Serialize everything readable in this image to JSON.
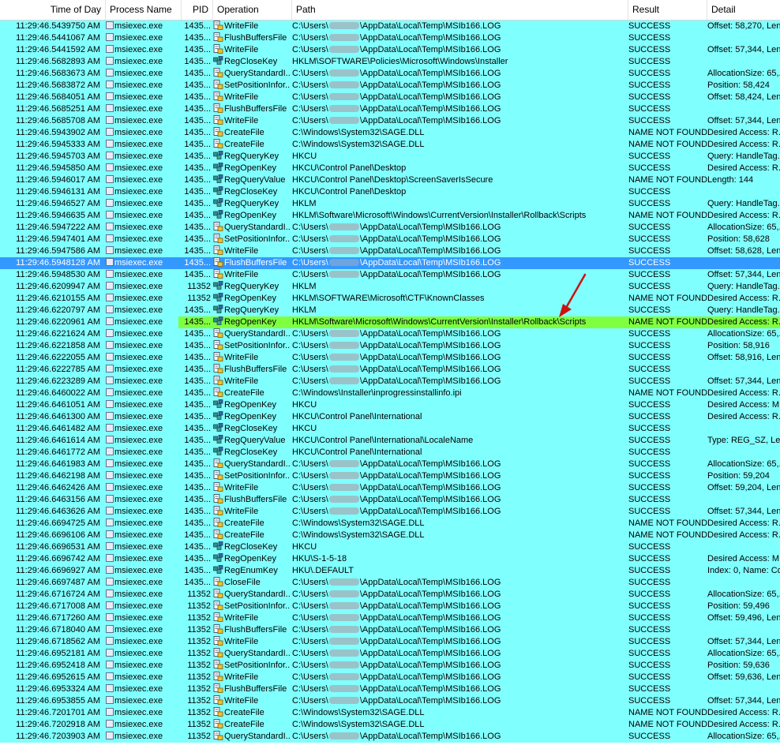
{
  "columns": {
    "time": "Time of Day",
    "process": "Process Name",
    "pid": "PID",
    "operation": "Operation",
    "path": "Path",
    "result": "Result",
    "detail": "Detail"
  },
  "colors": {
    "row_bg": "#80ffff",
    "selected_bg": "#3399ff",
    "highlight_bg": "#80ff40",
    "arrow": "#cc1111"
  },
  "rows": [
    {
      "time": "11:29:46.5439750 AM",
      "process": "msiexec.exe",
      "pid": "1435...",
      "op": "WriteFile",
      "icon": "file",
      "path": [
        "C:\\Users\\",
        "\\AppData\\Local\\Temp\\MSIb166.LOG"
      ],
      "result": "SUCCESS",
      "detail": "Offset: 58,270, Len"
    },
    {
      "time": "11:29:46.5441067 AM",
      "process": "msiexec.exe",
      "pid": "1435...",
      "op": "FlushBuffersFile",
      "icon": "file",
      "path": [
        "C:\\Users\\",
        "\\AppData\\Local\\Temp\\MSIb166.LOG"
      ],
      "result": "SUCCESS",
      "detail": ""
    },
    {
      "time": "11:29:46.5441592 AM",
      "process": "msiexec.exe",
      "pid": "1435...",
      "op": "WriteFile",
      "icon": "file",
      "path": [
        "C:\\Users\\",
        "\\AppData\\Local\\Temp\\MSIb166.LOG"
      ],
      "result": "SUCCESS",
      "detail": "Offset: 57,344, Len"
    },
    {
      "time": "11:29:46.5682893 AM",
      "process": "msiexec.exe",
      "pid": "1435...",
      "op": "RegCloseKey",
      "icon": "reg",
      "path": [
        "HKLM\\SOFTWARE\\Policies\\Microsoft\\Windows\\Installer"
      ],
      "result": "SUCCESS",
      "detail": ""
    },
    {
      "time": "11:29:46.5683673 AM",
      "process": "msiexec.exe",
      "pid": "1435...",
      "op": "QueryStandardI...",
      "icon": "file",
      "path": [
        "C:\\Users\\",
        "\\AppData\\Local\\Temp\\MSIb166.LOG"
      ],
      "result": "SUCCESS",
      "detail": "AllocationSize: 65,..."
    },
    {
      "time": "11:29:46.5683872 AM",
      "process": "msiexec.exe",
      "pid": "1435...",
      "op": "SetPositionInfor...",
      "icon": "file",
      "path": [
        "C:\\Users\\",
        "\\AppData\\Local\\Temp\\MSIb166.LOG"
      ],
      "result": "SUCCESS",
      "detail": "Position: 58,424"
    },
    {
      "time": "11:29:46.5684051 AM",
      "process": "msiexec.exe",
      "pid": "1435...",
      "op": "WriteFile",
      "icon": "file",
      "path": [
        "C:\\Users\\",
        "\\AppData\\Local\\Temp\\MSIb166.LOG"
      ],
      "result": "SUCCESS",
      "detail": "Offset: 58,424, Len"
    },
    {
      "time": "11:29:46.5685251 AM",
      "process": "msiexec.exe",
      "pid": "1435...",
      "op": "FlushBuffersFile",
      "icon": "file",
      "path": [
        "C:\\Users\\",
        "\\AppData\\Local\\Temp\\MSIb166.LOG"
      ],
      "result": "SUCCESS",
      "detail": ""
    },
    {
      "time": "11:29:46.5685708 AM",
      "process": "msiexec.exe",
      "pid": "1435...",
      "op": "WriteFile",
      "icon": "file",
      "path": [
        "C:\\Users\\",
        "\\AppData\\Local\\Temp\\MSIb166.LOG"
      ],
      "result": "SUCCESS",
      "detail": "Offset: 57,344, Len"
    },
    {
      "time": "11:29:46.5943902 AM",
      "process": "msiexec.exe",
      "pid": "1435...",
      "op": "CreateFile",
      "icon": "file",
      "path": [
        "C:\\Windows\\System32\\SAGE.DLL"
      ],
      "result": "NAME NOT FOUND",
      "detail": "Desired Access: R..."
    },
    {
      "time": "11:29:46.5945333 AM",
      "process": "msiexec.exe",
      "pid": "1435...",
      "op": "CreateFile",
      "icon": "file",
      "path": [
        "C:\\Windows\\System32\\SAGE.DLL"
      ],
      "result": "NAME NOT FOUND",
      "detail": "Desired Access: R..."
    },
    {
      "time": "11:29:46.5945703 AM",
      "process": "msiexec.exe",
      "pid": "1435...",
      "op": "RegQueryKey",
      "icon": "reg",
      "path": [
        "HKCU"
      ],
      "result": "SUCCESS",
      "detail": "Query: HandleTag..."
    },
    {
      "time": "11:29:46.5945850 AM",
      "process": "msiexec.exe",
      "pid": "1435...",
      "op": "RegOpenKey",
      "icon": "reg",
      "path": [
        "HKCU\\Control Panel\\Desktop"
      ],
      "result": "SUCCESS",
      "detail": "Desired Access: R..."
    },
    {
      "time": "11:29:46.5946017 AM",
      "process": "msiexec.exe",
      "pid": "1435...",
      "op": "RegQueryValue",
      "icon": "reg",
      "path": [
        "HKCU\\Control Panel\\Desktop\\ScreenSaverIsSecure"
      ],
      "result": "NAME NOT FOUND",
      "detail": "Length: 144"
    },
    {
      "time": "11:29:46.5946131 AM",
      "process": "msiexec.exe",
      "pid": "1435...",
      "op": "RegCloseKey",
      "icon": "reg",
      "path": [
        "HKCU\\Control Panel\\Desktop"
      ],
      "result": "SUCCESS",
      "detail": ""
    },
    {
      "time": "11:29:46.5946527 AM",
      "process": "msiexec.exe",
      "pid": "1435...",
      "op": "RegQueryKey",
      "icon": "reg",
      "path": [
        "HKLM"
      ],
      "result": "SUCCESS",
      "detail": "Query: HandleTag..."
    },
    {
      "time": "11:29:46.5946635 AM",
      "process": "msiexec.exe",
      "pid": "1435...",
      "op": "RegOpenKey",
      "icon": "reg",
      "path": [
        "HKLM\\Software\\Microsoft\\Windows\\CurrentVersion\\Installer\\Rollback\\Scripts"
      ],
      "result": "NAME NOT FOUND",
      "detail": "Desired Access: R..."
    },
    {
      "time": "11:29:46.5947222 AM",
      "process": "msiexec.exe",
      "pid": "1435...",
      "op": "QueryStandardI...",
      "icon": "file",
      "path": [
        "C:\\Users\\",
        "\\AppData\\Local\\Temp\\MSIb166.LOG"
      ],
      "result": "SUCCESS",
      "detail": "AllocationSize: 65,..."
    },
    {
      "time": "11:29:46.5947401 AM",
      "process": "msiexec.exe",
      "pid": "1435...",
      "op": "SetPositionInfor...",
      "icon": "file",
      "path": [
        "C:\\Users\\",
        "\\AppData\\Local\\Temp\\MSIb166.LOG"
      ],
      "result": "SUCCESS",
      "detail": "Position: 58,628"
    },
    {
      "time": "11:29:46.5947586 AM",
      "process": "msiexec.exe",
      "pid": "1435...",
      "op": "WriteFile",
      "icon": "file",
      "path": [
        "C:\\Users\\",
        "\\AppData\\Local\\Temp\\MSIb166.LOG"
      ],
      "result": "SUCCESS",
      "detail": "Offset: 58,628, Len"
    },
    {
      "time": "11:29:46.5948128 AM",
      "process": "msiexec.exe",
      "pid": "1435...",
      "op": "FlushBuffersFile",
      "icon": "file",
      "path": [
        "C:\\Users\\",
        "\\AppData\\Local\\Temp\\MSIb166.LOG"
      ],
      "result": "SUCCESS",
      "detail": "",
      "state": "selected"
    },
    {
      "time": "11:29:46.5948530 AM",
      "process": "msiexec.exe",
      "pid": "1435...",
      "op": "WriteFile",
      "icon": "file",
      "path": [
        "C:\\Users\\",
        "\\AppData\\Local\\Temp\\MSIb166.LOG"
      ],
      "result": "SUCCESS",
      "detail": "Offset: 57,344, Len"
    },
    {
      "time": "11:29:46.6209947 AM",
      "process": "msiexec.exe",
      "pid": "11352",
      "op": "RegQueryKey",
      "icon": "reg",
      "path": [
        "HKLM"
      ],
      "result": "SUCCESS",
      "detail": "Query: HandleTag..."
    },
    {
      "time": "11:29:46.6210155 AM",
      "process": "msiexec.exe",
      "pid": "11352",
      "op": "RegOpenKey",
      "icon": "reg",
      "path": [
        "HKLM\\SOFTWARE\\Microsoft\\CTF\\KnownClasses"
      ],
      "result": "NAME NOT FOUND",
      "detail": "Desired Access: R..."
    },
    {
      "time": "11:29:46.6220797 AM",
      "process": "msiexec.exe",
      "pid": "1435...",
      "op": "RegQueryKey",
      "icon": "reg",
      "path": [
        "HKLM"
      ],
      "result": "SUCCESS",
      "detail": "Query: HandleTag..."
    },
    {
      "time": "11:29:46.6220961 AM",
      "process": "msiexec.exe",
      "pid": "1435...",
      "op": "RegOpenKey",
      "icon": "reg",
      "path": [
        "HKLM\\Software\\Microsoft\\Windows\\CurrentVersion\\Installer\\Rollback\\Scripts"
      ],
      "result": "NAME NOT FOUND",
      "detail": "Desired Access: R...",
      "state": "highlighted"
    },
    {
      "time": "11:29:46.6221624 AM",
      "process": "msiexec.exe",
      "pid": "1435...",
      "op": "QueryStandardI...",
      "icon": "file",
      "path": [
        "C:\\Users\\",
        "\\AppData\\Local\\Temp\\MSIb166.LOG"
      ],
      "result": "SUCCESS",
      "detail": "AllocationSize: 65,..."
    },
    {
      "time": "11:29:46.6221858 AM",
      "process": "msiexec.exe",
      "pid": "1435...",
      "op": "SetPositionInfor...",
      "icon": "file",
      "path": [
        "C:\\Users\\",
        "\\AppData\\Local\\Temp\\MSIb166.LOG"
      ],
      "result": "SUCCESS",
      "detail": "Position: 58,916"
    },
    {
      "time": "11:29:46.6222055 AM",
      "process": "msiexec.exe",
      "pid": "1435...",
      "op": "WriteFile",
      "icon": "file",
      "path": [
        "C:\\Users\\",
        "\\AppData\\Local\\Temp\\MSIb166.LOG"
      ],
      "result": "SUCCESS",
      "detail": "Offset: 58,916, Len"
    },
    {
      "time": "11:29:46.6222785 AM",
      "process": "msiexec.exe",
      "pid": "1435...",
      "op": "FlushBuffersFile",
      "icon": "file",
      "path": [
        "C:\\Users\\",
        "\\AppData\\Local\\Temp\\MSIb166.LOG"
      ],
      "result": "SUCCESS",
      "detail": ""
    },
    {
      "time": "11:29:46.6223289 AM",
      "process": "msiexec.exe",
      "pid": "1435...",
      "op": "WriteFile",
      "icon": "file",
      "path": [
        "C:\\Users\\",
        "\\AppData\\Local\\Temp\\MSIb166.LOG"
      ],
      "result": "SUCCESS",
      "detail": "Offset: 57,344, Len"
    },
    {
      "time": "11:29:46.6460022 AM",
      "process": "msiexec.exe",
      "pid": "1435...",
      "op": "CreateFile",
      "icon": "file",
      "path": [
        "C:\\Windows\\Installer\\inprogressinstallinfo.ipi"
      ],
      "result": "NAME NOT FOUND",
      "detail": "Desired Access: R..."
    },
    {
      "time": "11:29:46.6461051 AM",
      "process": "msiexec.exe",
      "pid": "1435...",
      "op": "RegOpenKey",
      "icon": "reg",
      "path": [
        "HKCU"
      ],
      "result": "SUCCESS",
      "detail": "Desired Access: M..."
    },
    {
      "time": "11:29:46.6461300 AM",
      "process": "msiexec.exe",
      "pid": "1435...",
      "op": "RegOpenKey",
      "icon": "reg",
      "path": [
        "HKCU\\Control Panel\\International"
      ],
      "result": "SUCCESS",
      "detail": "Desired Access: R..."
    },
    {
      "time": "11:29:46.6461482 AM",
      "process": "msiexec.exe",
      "pid": "1435...",
      "op": "RegCloseKey",
      "icon": "reg",
      "path": [
        "HKCU"
      ],
      "result": "SUCCESS",
      "detail": ""
    },
    {
      "time": "11:29:46.6461614 AM",
      "process": "msiexec.exe",
      "pid": "1435...",
      "op": "RegQueryValue",
      "icon": "reg",
      "path": [
        "HKCU\\Control Panel\\International\\LocaleName"
      ],
      "result": "SUCCESS",
      "detail": "Type: REG_SZ, Len"
    },
    {
      "time": "11:29:46.6461772 AM",
      "process": "msiexec.exe",
      "pid": "1435...",
      "op": "RegCloseKey",
      "icon": "reg",
      "path": [
        "HKCU\\Control Panel\\International"
      ],
      "result": "SUCCESS",
      "detail": ""
    },
    {
      "time": "11:29:46.6461983 AM",
      "process": "msiexec.exe",
      "pid": "1435...",
      "op": "QueryStandardI...",
      "icon": "file",
      "path": [
        "C:\\Users\\",
        "\\AppData\\Local\\Temp\\MSIb166.LOG"
      ],
      "result": "SUCCESS",
      "detail": "AllocationSize: 65,..."
    },
    {
      "time": "11:29:46.6462198 AM",
      "process": "msiexec.exe",
      "pid": "1435...",
      "op": "SetPositionInfor...",
      "icon": "file",
      "path": [
        "C:\\Users\\",
        "\\AppData\\Local\\Temp\\MSIb166.LOG"
      ],
      "result": "SUCCESS",
      "detail": "Position: 59,204"
    },
    {
      "time": "11:29:46.6462426 AM",
      "process": "msiexec.exe",
      "pid": "1435...",
      "op": "WriteFile",
      "icon": "file",
      "path": [
        "C:\\Users\\",
        "\\AppData\\Local\\Temp\\MSIb166.LOG"
      ],
      "result": "SUCCESS",
      "detail": "Offset: 59,204, Len"
    },
    {
      "time": "11:29:46.6463156 AM",
      "process": "msiexec.exe",
      "pid": "1435...",
      "op": "FlushBuffersFile",
      "icon": "file",
      "path": [
        "C:\\Users\\",
        "\\AppData\\Local\\Temp\\MSIb166.LOG"
      ],
      "result": "SUCCESS",
      "detail": ""
    },
    {
      "time": "11:29:46.6463626 AM",
      "process": "msiexec.exe",
      "pid": "1435...",
      "op": "WriteFile",
      "icon": "file",
      "path": [
        "C:\\Users\\",
        "\\AppData\\Local\\Temp\\MSIb166.LOG"
      ],
      "result": "SUCCESS",
      "detail": "Offset: 57,344, Len"
    },
    {
      "time": "11:29:46.6694725 AM",
      "process": "msiexec.exe",
      "pid": "1435...",
      "op": "CreateFile",
      "icon": "file",
      "path": [
        "C:\\Windows\\System32\\SAGE.DLL"
      ],
      "result": "NAME NOT FOUND",
      "detail": "Desired Access: R..."
    },
    {
      "time": "11:29:46.6696106 AM",
      "process": "msiexec.exe",
      "pid": "1435...",
      "op": "CreateFile",
      "icon": "file",
      "path": [
        "C:\\Windows\\System32\\SAGE.DLL"
      ],
      "result": "NAME NOT FOUND",
      "detail": "Desired Access: R..."
    },
    {
      "time": "11:29:46.6696531 AM",
      "process": "msiexec.exe",
      "pid": "1435...",
      "op": "RegCloseKey",
      "icon": "reg",
      "path": [
        "HKCU"
      ],
      "result": "SUCCESS",
      "detail": ""
    },
    {
      "time": "11:29:46.6696742 AM",
      "process": "msiexec.exe",
      "pid": "1435...",
      "op": "RegOpenKey",
      "icon": "reg",
      "path": [
        "HKU\\S-1-5-18"
      ],
      "result": "SUCCESS",
      "detail": "Desired Access: M..."
    },
    {
      "time": "11:29:46.6696927 AM",
      "process": "msiexec.exe",
      "pid": "1435...",
      "op": "RegEnumKey",
      "icon": "reg",
      "path": [
        "HKU\\.DEFAULT"
      ],
      "result": "SUCCESS",
      "detail": "Index: 0, Name: Co"
    },
    {
      "time": "11:29:46.6697487 AM",
      "process": "msiexec.exe",
      "pid": "1435...",
      "op": "CloseFile",
      "icon": "file",
      "path": [
        "C:\\Users\\",
        "\\AppData\\Local\\Temp\\MSIb166.LOG"
      ],
      "result": "SUCCESS",
      "detail": ""
    },
    {
      "time": "11:29:46.6716724 AM",
      "process": "msiexec.exe",
      "pid": "11352",
      "op": "QueryStandardI...",
      "icon": "file",
      "path": [
        "C:\\Users\\",
        "\\AppData\\Local\\Temp\\MSIb166.LOG"
      ],
      "result": "SUCCESS",
      "detail": "AllocationSize: 65,..."
    },
    {
      "time": "11:29:46.6717008 AM",
      "process": "msiexec.exe",
      "pid": "11352",
      "op": "SetPositionInfor...",
      "icon": "file",
      "path": [
        "C:\\Users\\",
        "\\AppData\\Local\\Temp\\MSIb166.LOG"
      ],
      "result": "SUCCESS",
      "detail": "Position: 59,496"
    },
    {
      "time": "11:29:46.6717260 AM",
      "process": "msiexec.exe",
      "pid": "11352",
      "op": "WriteFile",
      "icon": "file",
      "path": [
        "C:\\Users\\",
        "\\AppData\\Local\\Temp\\MSIb166.LOG"
      ],
      "result": "SUCCESS",
      "detail": "Offset: 59,496, Len"
    },
    {
      "time": "11:29:46.6718040 AM",
      "process": "msiexec.exe",
      "pid": "11352",
      "op": "FlushBuffersFile",
      "icon": "file",
      "path": [
        "C:\\Users\\",
        "\\AppData\\Local\\Temp\\MSIb166.LOG"
      ],
      "result": "SUCCESS",
      "detail": ""
    },
    {
      "time": "11:29:46.6718562 AM",
      "process": "msiexec.exe",
      "pid": "11352",
      "op": "WriteFile",
      "icon": "file",
      "path": [
        "C:\\Users\\",
        "\\AppData\\Local\\Temp\\MSIb166.LOG"
      ],
      "result": "SUCCESS",
      "detail": "Offset: 57,344, Len"
    },
    {
      "time": "11:29:46.6952181 AM",
      "process": "msiexec.exe",
      "pid": "11352",
      "op": "QueryStandardI...",
      "icon": "file",
      "path": [
        "C:\\Users\\",
        "\\AppData\\Local\\Temp\\MSIb166.LOG"
      ],
      "result": "SUCCESS",
      "detail": "AllocationSize: 65,..."
    },
    {
      "time": "11:29:46.6952418 AM",
      "process": "msiexec.exe",
      "pid": "11352",
      "op": "SetPositionInfor...",
      "icon": "file",
      "path": [
        "C:\\Users\\",
        "\\AppData\\Local\\Temp\\MSIb166.LOG"
      ],
      "result": "SUCCESS",
      "detail": "Position: 59,636"
    },
    {
      "time": "11:29:46.6952615 AM",
      "process": "msiexec.exe",
      "pid": "11352",
      "op": "WriteFile",
      "icon": "file",
      "path": [
        "C:\\Users\\",
        "\\AppData\\Local\\Temp\\MSIb166.LOG"
      ],
      "result": "SUCCESS",
      "detail": "Offset: 59,636, Len"
    },
    {
      "time": "11:29:46.6953324 AM",
      "process": "msiexec.exe",
      "pid": "11352",
      "op": "FlushBuffersFile",
      "icon": "file",
      "path": [
        "C:\\Users\\",
        "\\AppData\\Local\\Temp\\MSIb166.LOG"
      ],
      "result": "SUCCESS",
      "detail": ""
    },
    {
      "time": "11:29:46.6953855 AM",
      "process": "msiexec.exe",
      "pid": "11352",
      "op": "WriteFile",
      "icon": "file",
      "path": [
        "C:\\Users\\",
        "\\AppData\\Local\\Temp\\MSIb166.LOG"
      ],
      "result": "SUCCESS",
      "detail": "Offset: 57,344, Len"
    },
    {
      "time": "11:29:46.7201701 AM",
      "process": "msiexec.exe",
      "pid": "11352",
      "op": "CreateFile",
      "icon": "file",
      "path": [
        "C:\\Windows\\System32\\SAGE.DLL"
      ],
      "result": "NAME NOT FOUND",
      "detail": "Desired Access: R..."
    },
    {
      "time": "11:29:46.7202918 AM",
      "process": "msiexec.exe",
      "pid": "11352",
      "op": "CreateFile",
      "icon": "file",
      "path": [
        "C:\\Windows\\System32\\SAGE.DLL"
      ],
      "result": "NAME NOT FOUND",
      "detail": "Desired Access: R..."
    },
    {
      "time": "11:29:46.7203903 AM",
      "process": "msiexec.exe",
      "pid": "11352",
      "op": "QueryStandardI...",
      "icon": "file",
      "path": [
        "C:\\Users\\",
        "\\AppData\\Local\\Temp\\MSIb166.LOG"
      ],
      "result": "SUCCESS",
      "detail": "AllocationSize: 65,..."
    }
  ]
}
